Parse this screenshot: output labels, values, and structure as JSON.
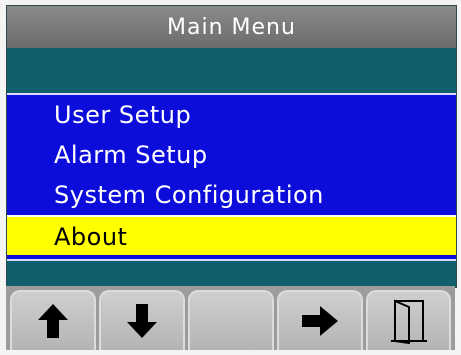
{
  "title": "Main Menu",
  "menu": {
    "items": [
      {
        "label": "User Setup",
        "selected": false
      },
      {
        "label": "Alarm Setup",
        "selected": false
      },
      {
        "label": "System Configuration",
        "selected": false
      },
      {
        "label": "About",
        "selected": true
      }
    ]
  },
  "softkeys": [
    {
      "icon": "arrow-up-icon"
    },
    {
      "icon": "arrow-down-icon"
    },
    {
      "icon": ""
    },
    {
      "icon": "arrow-right-icon"
    },
    {
      "icon": "exit-door-icon"
    }
  ],
  "colors": {
    "title_bar": "#7a7a7a",
    "background": "#0f5f6c",
    "menu_bg": "#0d0ddb",
    "selected_bg": "#ffff00",
    "selected_text": "#000000",
    "menu_text": "#ffffff"
  }
}
